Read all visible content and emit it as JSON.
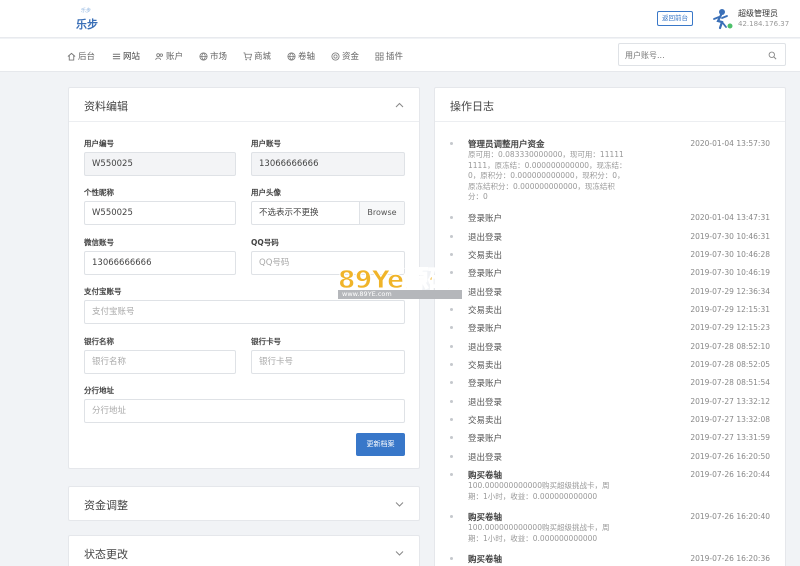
{
  "header": {
    "logo_small": "乐步",
    "logo_main": "乐步",
    "back_button": "返回前台",
    "user_name": "超级管理员",
    "user_ip": "42.184.176.37"
  },
  "nav": {
    "items": [
      {
        "label": "后台",
        "icon": "home-icon"
      },
      {
        "label": "网站",
        "icon": "list-icon"
      },
      {
        "label": "账户",
        "icon": "users-icon"
      },
      {
        "label": "市场",
        "icon": "globe-icon"
      },
      {
        "label": "商城",
        "icon": "cart-icon"
      },
      {
        "label": "卷轴",
        "icon": "globe-icon"
      },
      {
        "label": "资金",
        "icon": "coin-icon"
      },
      {
        "label": "插件",
        "icon": "grid-icon"
      }
    ],
    "search_placeholder": "用户账号..."
  },
  "profile": {
    "title": "资料编辑",
    "user_id_label": "用户编号",
    "user_id_value": "W550025",
    "account_label": "用户账号",
    "account_value": "13066666666",
    "nickname_label": "个性昵称",
    "nickname_value": "W550025",
    "avatar_label": "用户头像",
    "avatar_placeholder": "不选表示不更换",
    "browse_label": "Browse",
    "wechat_label": "微信账号",
    "wechat_value": "13066666666",
    "qq_label": "QQ号码",
    "qq_placeholder": "QQ号码",
    "alipay_label": "支付宝账号",
    "alipay_placeholder": "支付宝账号",
    "bank_name_label": "银行名称",
    "bank_name_placeholder": "银行名称",
    "bank_card_label": "银行卡号",
    "bank_card_placeholder": "银行卡号",
    "branch_label": "分行地址",
    "branch_placeholder": "分行地址",
    "save_button": "更新档案"
  },
  "funds_panel": {
    "title": "资金调整"
  },
  "status_panel": {
    "title": "状态更改"
  },
  "log": {
    "title": "操作日志",
    "entries": [
      {
        "title": "管理员调整用户资金",
        "time": "2020-01-04 13:57:30",
        "bold": true,
        "desc": "原可用：0.083330000000，现可用：111111111，原冻结：0.000000000000，现冻结：0，原积分：0.000000000000，现积分：0，原冻结积分：0.000000000000，现冻结积分：0"
      },
      {
        "title": "登录账户",
        "time": "2020-01-04 13:47:31"
      },
      {
        "title": "退出登录",
        "time": "2019-07-30 10:46:31"
      },
      {
        "title": "交易卖出",
        "time": "2019-07-30 10:46:28"
      },
      {
        "title": "登录账户",
        "time": "2019-07-30 10:46:19"
      },
      {
        "title": "退出登录",
        "time": "2019-07-29 12:36:34"
      },
      {
        "title": "交易卖出",
        "time": "2019-07-29 12:15:31"
      },
      {
        "title": "登录账户",
        "time": "2019-07-29 12:15:23"
      },
      {
        "title": "退出登录",
        "time": "2019-07-28 08:52:10"
      },
      {
        "title": "交易卖出",
        "time": "2019-07-28 08:52:05"
      },
      {
        "title": "登录账户",
        "time": "2019-07-28 08:51:54"
      },
      {
        "title": "退出登录",
        "time": "2019-07-27 13:32:12"
      },
      {
        "title": "交易卖出",
        "time": "2019-07-27 13:32:08"
      },
      {
        "title": "登录账户",
        "time": "2019-07-27 13:31:59"
      },
      {
        "title": "退出登录",
        "time": "2019-07-26 16:20:50"
      },
      {
        "title": "购买卷轴",
        "time": "2019-07-26 16:20:44",
        "bold": true,
        "desc": "100.000000000000购买超级挑战卡，周期：1小时，收益：0.000000000000"
      },
      {
        "title": "购买卷轴",
        "time": "2019-07-26 16:20:40",
        "bold": true,
        "desc": "100.000000000000购买超级挑战卡，周期：1小时，收益：0.000000000000"
      },
      {
        "title": "购买卷轴",
        "time": "2019-07-26 16:20:36",
        "bold": true
      }
    ]
  },
  "watermark": {
    "text": "89Ye源码",
    "url": "www.89YE.com"
  }
}
